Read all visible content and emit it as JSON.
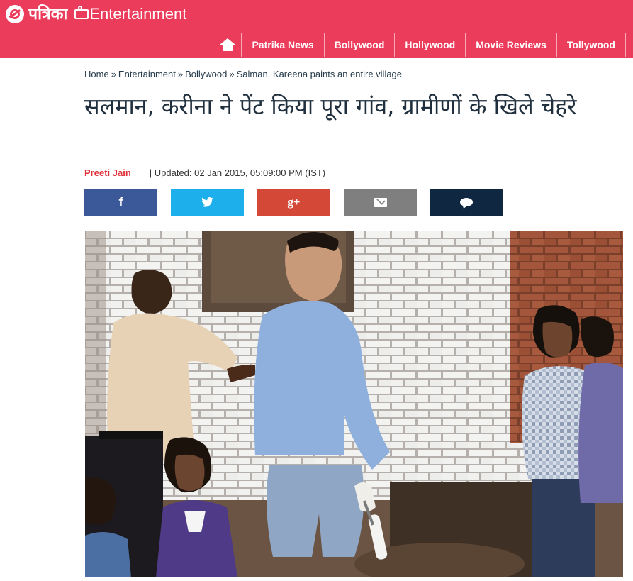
{
  "header": {
    "brand": "पत्रिका",
    "section": "Entertainment",
    "bg_color": "#ec3c5c"
  },
  "nav": {
    "home_icon": "home-icon",
    "items": [
      "Patrika News",
      "Bollywood",
      "Hollywood",
      "Movie Reviews",
      "Tollywood"
    ]
  },
  "breadcrumb": [
    "Home",
    "Entertainment",
    "Bollywood",
    "Salman, Kareena paints an entire village"
  ],
  "breadcrumb_separator": "»",
  "article": {
    "title": "सलमान, करीना ने पेंट किया पूरा गांव, ग्रामीणों के खिले चेहरे",
    "author": "Preeti Jain",
    "updated": "| Updated: 02 Jan 2015, 05:09:00 PM (IST)"
  },
  "share": {
    "facebook": "f",
    "googleplus": "g+",
    "icons": [
      "facebook-icon",
      "twitter-icon",
      "googleplus-icon",
      "email-icon",
      "comment-icon"
    ],
    "colors": {
      "facebook": "#3b5998",
      "twitter": "#1dafec",
      "googleplus": "#d34836",
      "email": "#7f7f7f",
      "comment": "#0f2740"
    }
  }
}
